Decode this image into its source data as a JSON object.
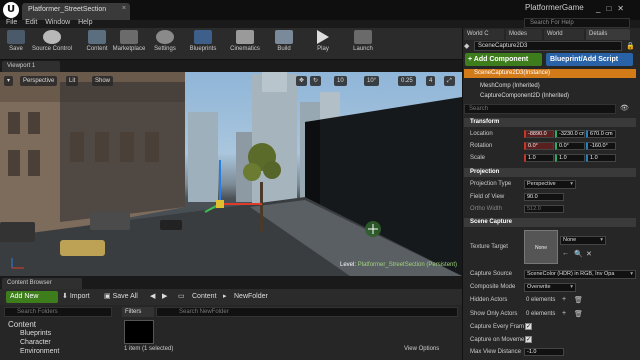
{
  "window": {
    "tab_title": "Platformer_StreetSection",
    "app_name": "PlatformerGame",
    "help_search_placeholder": "Search For Help",
    "minimize": "_",
    "maximize": "□",
    "close": "✕"
  },
  "menu": [
    "File",
    "Edit",
    "Window",
    "Help"
  ],
  "toolbar": [
    "Save",
    "Source Control",
    "Content",
    "Marketplace",
    "Settings",
    "Blueprints",
    "Cinematics",
    "Build",
    "Play",
    "Launch"
  ],
  "viewport": {
    "tab": "Viewport 1",
    "perspective": "Perspective",
    "lit": "Lit",
    "show": "Show",
    "snap_grid": "10",
    "snap_rot": "10°",
    "snap_scale": "0.25",
    "cam_speed": "4",
    "level_prefix": "Level:",
    "level_name": "Platformer_StreetSection (Persistent)"
  },
  "content_browser": {
    "tab": "Content Browser",
    "add_new": "Add New",
    "import": "Import",
    "save_all": "Save All",
    "path": [
      "Content",
      "NewFolder"
    ],
    "folder_search_placeholder": "Search Folders",
    "filters": "Filters",
    "asset_search_placeholder": "Search NewFolder",
    "tree": [
      "Content",
      "Blueprints",
      "Character",
      "Environment"
    ],
    "status": "1 item (1 selected)",
    "view_options": "View Options"
  },
  "right_panel": {
    "tabs": [
      "World C",
      "Modes",
      "World",
      "Details"
    ],
    "actor_name": "SceneCapture2D3",
    "add_component": "+ Add Component",
    "blueprint_script": "Blueprint/Add Script",
    "components": [
      "SceneCapture2D3(Instance)",
      "MeshComp (Inherited)",
      "CaptureComponent2D (Inherited)"
    ],
    "search_placeholder": "Search",
    "transform": {
      "header": "Transform",
      "location_label": "Location",
      "location": [
        "-8890.0",
        "-3230.0 cm",
        "670.0 cm"
      ],
      "rotation_label": "Rotation",
      "rotation": [
        "0.0°",
        "0.0°",
        "-160.0°"
      ],
      "scale_label": "Scale",
      "scale": [
        "1.0",
        "1.0",
        "1.0"
      ]
    },
    "projection": {
      "header": "Projection",
      "type_label": "Projection Type",
      "type": "Perspective",
      "fov_label": "Field of View",
      "fov": "90.0",
      "ortho_label": "Ortho Width",
      "ortho": "512.0"
    },
    "scene_capture": {
      "header": "Scene Capture",
      "texture_target_label": "Texture Target",
      "texture_target_thumb": "None",
      "texture_target_value": "None",
      "capture_source_label": "Capture Source",
      "capture_source": "SceneColor (HDR) in RGB, Inv Opa",
      "composite_label": "Composite Mode",
      "composite": "Overwrite",
      "hidden_actors_label": "Hidden Actors",
      "hidden_actors": "0 elements",
      "show_only_label": "Show Only Actors",
      "show_only": "0 elements",
      "capture_every_frame_label": "Capture Every Fram",
      "capture_on_movement_label": "Capture on Moveme",
      "max_view_label": "Max View Distance",
      "max_view": "-1.0"
    }
  },
  "colors": {
    "add_green": "#3e7d1c",
    "blueprint_blue": "#2a62a8",
    "selected_orange": "#d47b19"
  }
}
